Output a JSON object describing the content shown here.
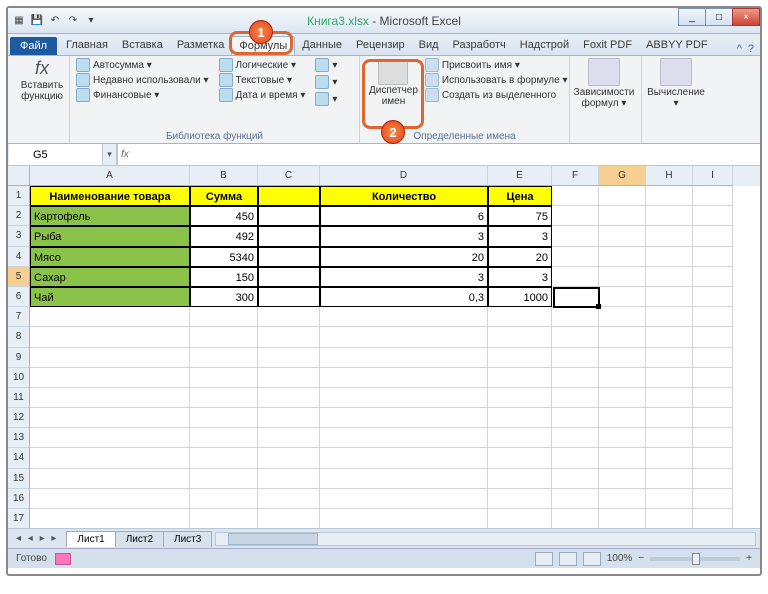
{
  "title": {
    "doc": "Книга3.xlsx",
    "app": "Microsoft Excel"
  },
  "qat": {
    "save": "💾",
    "undo": "↶",
    "redo": "↷"
  },
  "win": {
    "min": "_",
    "max": "□",
    "close": "×"
  },
  "tabs": {
    "file": "Файл",
    "items": [
      "Главная",
      "Вставка",
      "Разметка",
      "Формулы",
      "Данные",
      "Рецензир",
      "Вид",
      "Разработч",
      "Надстрой",
      "Foxit PDF",
      "ABBYY PDF"
    ],
    "active_index": 3
  },
  "ribbon": {
    "insert_fn": "Вставить\nфункцию",
    "lib": {
      "col1": [
        "Автосумма ▾",
        "Недавно использовали ▾",
        "Финансовые ▾"
      ],
      "col2": [
        "Логические ▾",
        "Текстовые ▾",
        "Дата и время ▾"
      ],
      "label": "Библиотека функций"
    },
    "name_mgr": "Диспетчер\nимен",
    "names_sub": [
      "Присвоить имя ▾",
      "Использовать в формуле ▾",
      "Создать из выделенного"
    ],
    "names_label": "Определенные имена",
    "deps": "Зависимости\nформул ▾",
    "calc": "Вычисление\n▾"
  },
  "callouts": {
    "b1": "1",
    "b2": "2"
  },
  "namebox": {
    "ref": "G5",
    "formula": ""
  },
  "columns": [
    "A",
    "B",
    "C",
    "D",
    "E",
    "F",
    "G",
    "H",
    "I"
  ],
  "rows_count": 17,
  "headers": [
    "Наименование товара",
    "Сумма",
    "",
    "Количество",
    "Цена"
  ],
  "data": [
    {
      "name": "Картофель",
      "sum": "450",
      "c": "",
      "qty": "6",
      "price": "75"
    },
    {
      "name": "Рыба",
      "sum": "492",
      "c": "",
      "qty": "3",
      "price": "3"
    },
    {
      "name": "Мясо",
      "sum": "5340",
      "c": "",
      "qty": "20",
      "price": "20"
    },
    {
      "name": "Сахар",
      "sum": "150",
      "c": "",
      "qty": "3",
      "price": "3"
    },
    {
      "name": "Чай",
      "sum": "300",
      "c": "",
      "qty": "0,3",
      "price": "1000"
    }
  ],
  "highlight_row": 5,
  "sheets": {
    "active": "Лист1",
    "others": [
      "Лист2",
      "Лист3"
    ]
  },
  "status": {
    "ready": "Готово",
    "zoom": "100%",
    "minus": "−",
    "plus": "+"
  }
}
